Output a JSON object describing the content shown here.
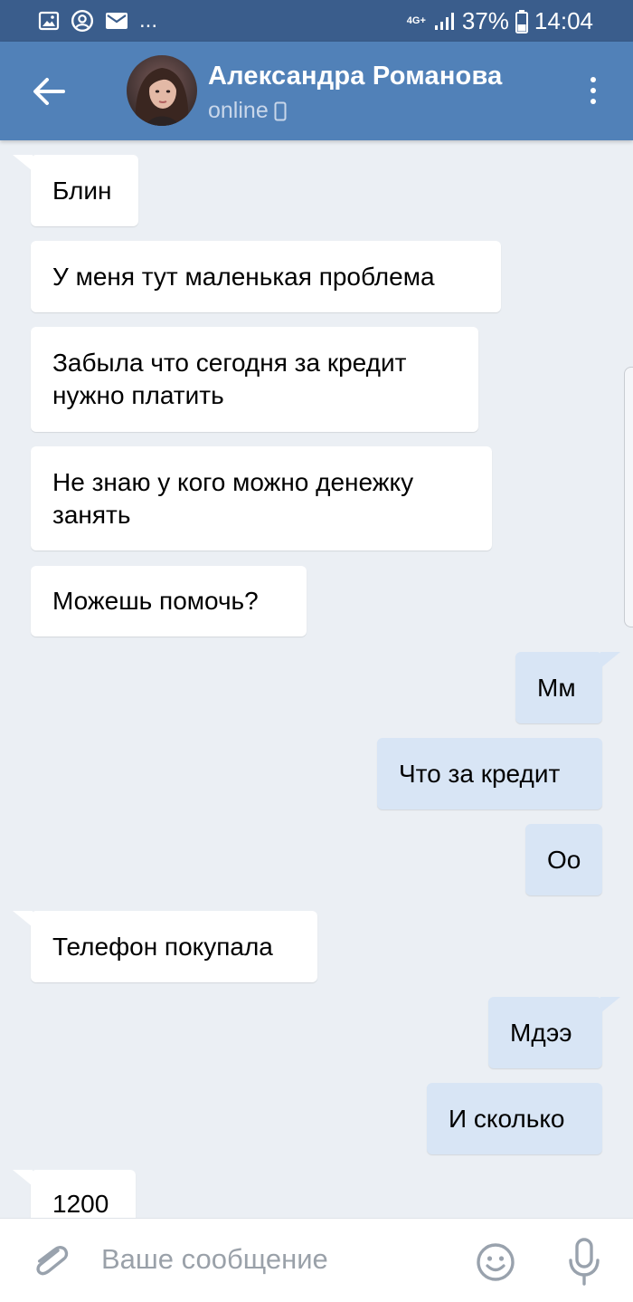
{
  "status_bar": {
    "notification_icons": [
      "image-icon",
      "account-circle-icon",
      "mail-icon"
    ],
    "more": "...",
    "network": "4G+",
    "battery": "37%",
    "time": "14:04"
  },
  "header": {
    "contact_name": "Александра Романова",
    "status": "online"
  },
  "messages": [
    {
      "direction": "in",
      "text": "Блин"
    },
    {
      "direction": "in",
      "text": "У меня тут маленькая проблема"
    },
    {
      "direction": "in",
      "text": "Забыла что сегодня за кредит нужно платить"
    },
    {
      "direction": "in",
      "text": "Не знаю у кого можно денежку занять"
    },
    {
      "direction": "in",
      "text": "Можешь помочь?"
    },
    {
      "direction": "out",
      "text": "Мм"
    },
    {
      "direction": "out",
      "text": "Что за кредит"
    },
    {
      "direction": "out",
      "text": "Оо"
    },
    {
      "direction": "in",
      "text": "Телефон покупала"
    },
    {
      "direction": "out",
      "text": "Мдээ"
    },
    {
      "direction": "out",
      "text": "И сколько"
    },
    {
      "direction": "in",
      "text": "1200"
    }
  ],
  "composer": {
    "placeholder": "Ваше сообщение"
  },
  "colors": {
    "status_bar": "#3a5d8c",
    "header": "#5181b8",
    "background": "#ebeff4",
    "incoming_bubble": "#ffffff",
    "outgoing_bubble": "#d8e5f5"
  }
}
